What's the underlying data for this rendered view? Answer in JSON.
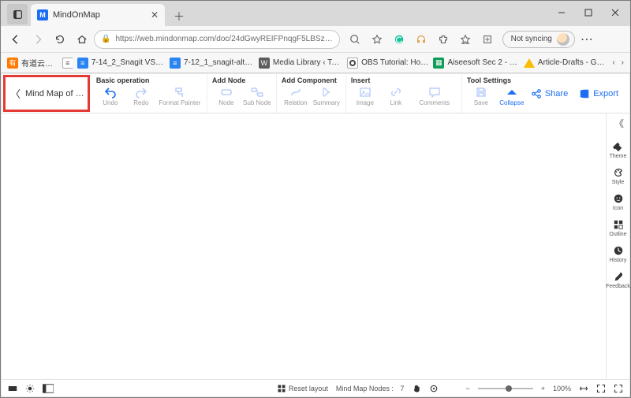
{
  "browser": {
    "tab_title": "MindOnMap",
    "url": "https://web.mindonmap.com/doc/24dGwyREIFPnqgF5LBSz…",
    "sync_label": "Not syncing",
    "bookmarks": [
      {
        "label": "有道云笔记",
        "icon": "ydy"
      },
      {
        "label": "",
        "icon": "reading"
      },
      {
        "label": "7-14_2_Snagit VS S…",
        "icon": "gdoc"
      },
      {
        "label": "7-12_1_snagit-alter…",
        "icon": "gdoc"
      },
      {
        "label": "Media Library ‹ Top…",
        "icon": "wp"
      },
      {
        "label": "OBS Tutorial: How…",
        "icon": "obs"
      },
      {
        "label": "Aiseesoft Sec 2 - W…",
        "icon": "sheet"
      },
      {
        "label": "Article-Drafts - Goo…",
        "icon": "gdrive"
      }
    ]
  },
  "app": {
    "doc_title": "Mind Map of …",
    "groups": {
      "basic": {
        "header": "Basic operation",
        "tools": [
          "Undo",
          "Redo",
          "Format Painter"
        ]
      },
      "node": {
        "header": "Add Node",
        "tools": [
          "Node",
          "Sub Node"
        ]
      },
      "comp": {
        "header": "Add Component",
        "tools": [
          "Relation",
          "Summary"
        ]
      },
      "insert": {
        "header": "Insert",
        "tools": [
          "Image",
          "Link",
          "Comments"
        ]
      },
      "tool": {
        "header": "Tool Settings",
        "tools": [
          "Save",
          "Collapse"
        ]
      }
    },
    "share_label": "Share",
    "export_label": "Export",
    "right_panel": [
      "Theme",
      "Style",
      "Icon",
      "Outline",
      "History",
      "Feedback"
    ],
    "status": {
      "reset_label": "Reset layout",
      "nodes_label": "Mind Map Nodes :",
      "nodes_count": "7",
      "zoom_pct": "100%"
    }
  }
}
